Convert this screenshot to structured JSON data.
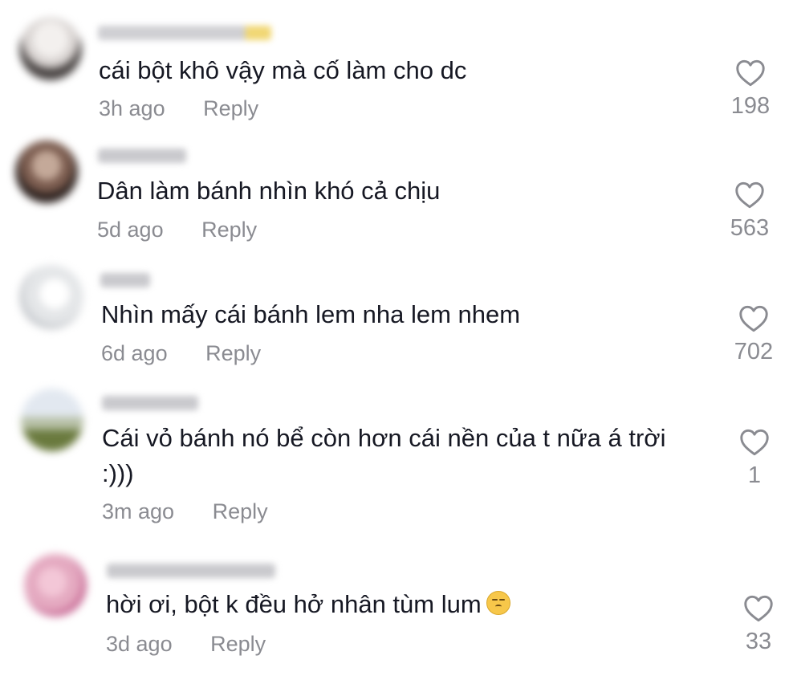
{
  "comments": [
    {
      "text": "cái bột khô vậy mà cố làm cho dc",
      "time": "3h ago",
      "reply_label": "Reply",
      "likes": "198",
      "avatar_colors": [
        "#e8e4e2",
        "#4a4544"
      ],
      "username_accent": "#f1d774"
    },
    {
      "text": "Dân làm bánh nhìn khó cả chịu",
      "time": "5d ago",
      "reply_label": "Reply",
      "likes": "563",
      "avatar_colors": [
        "#a68a7a",
        "#2e2320"
      ],
      "username_accent": ""
    },
    {
      "text": "Nhìn mấy cái bánh lem nha lem nhem",
      "time": "6d ago",
      "reply_label": "Reply",
      "likes": "702",
      "avatar_colors": [
        "#f1f1f1",
        "#c9ccd0"
      ],
      "username_accent": ""
    },
    {
      "text": "Cái vỏ bánh nó bể còn hơn cái nền của t nữa á trời",
      "text_line2": ":)))",
      "time": "3m ago",
      "reply_label": "Reply",
      "likes": "1",
      "avatar_colors": [
        "#d6dde8",
        "#6a7a3e"
      ],
      "username_accent": ""
    },
    {
      "text": "hời ơi, bột k đều hở nhân tùm lum",
      "emoji": "unamused-face-emoji",
      "time": "3d ago",
      "reply_label": "Reply",
      "likes": "33",
      "avatar_colors": [
        "#e4a9c0",
        "#c86a95"
      ],
      "username_accent": ""
    }
  ],
  "icons": {
    "like": "heart-outline-icon"
  },
  "colors": {
    "text": "#161823",
    "secondary": "#8a8b91",
    "background": "#ffffff"
  }
}
